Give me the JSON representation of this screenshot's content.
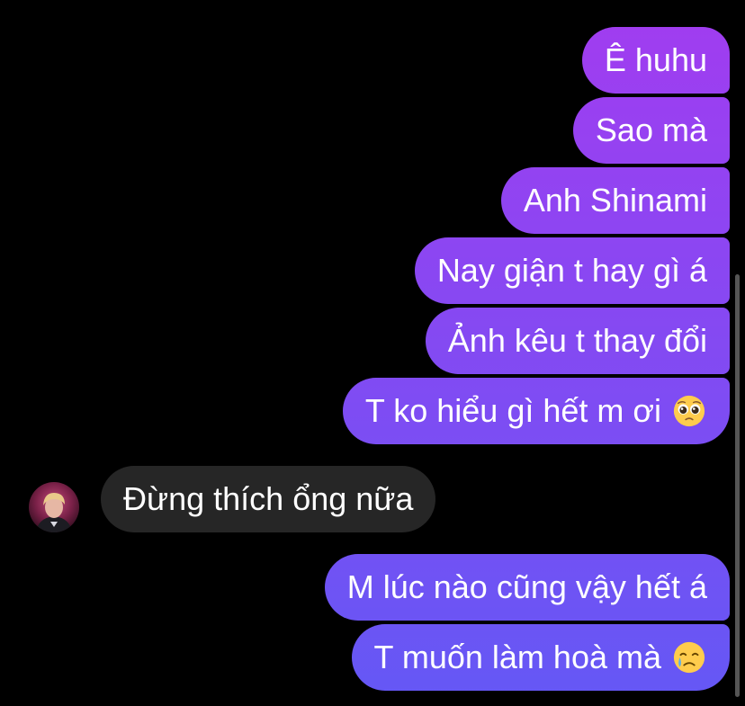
{
  "colors": {
    "background": "#000000",
    "incoming_bubble": "#262626",
    "outgoing_top": "#a23cf0",
    "outgoing_bottom": "#6458f5",
    "text": "#ffffff"
  },
  "conversation": {
    "outgoing_group_1": [
      {
        "text": "Ê huhu"
      },
      {
        "text": "Sao mà"
      },
      {
        "text": "Anh Shinami"
      },
      {
        "text": "Nay giận t hay gì á"
      },
      {
        "text": "Ảnh kêu t thay đổi"
      },
      {
        "text": "T ko hiểu gì hết m ơi",
        "emoji": "pleading-face-icon"
      }
    ],
    "incoming": {
      "text": "Đừng thích ổng nữa",
      "avatar": "user-avatar-photo"
    },
    "outgoing_group_2": [
      {
        "text": "M lúc nào cũng vậy hết á"
      },
      {
        "text": "T muốn làm hoà mà",
        "emoji": "crying-face-icon"
      }
    ]
  }
}
